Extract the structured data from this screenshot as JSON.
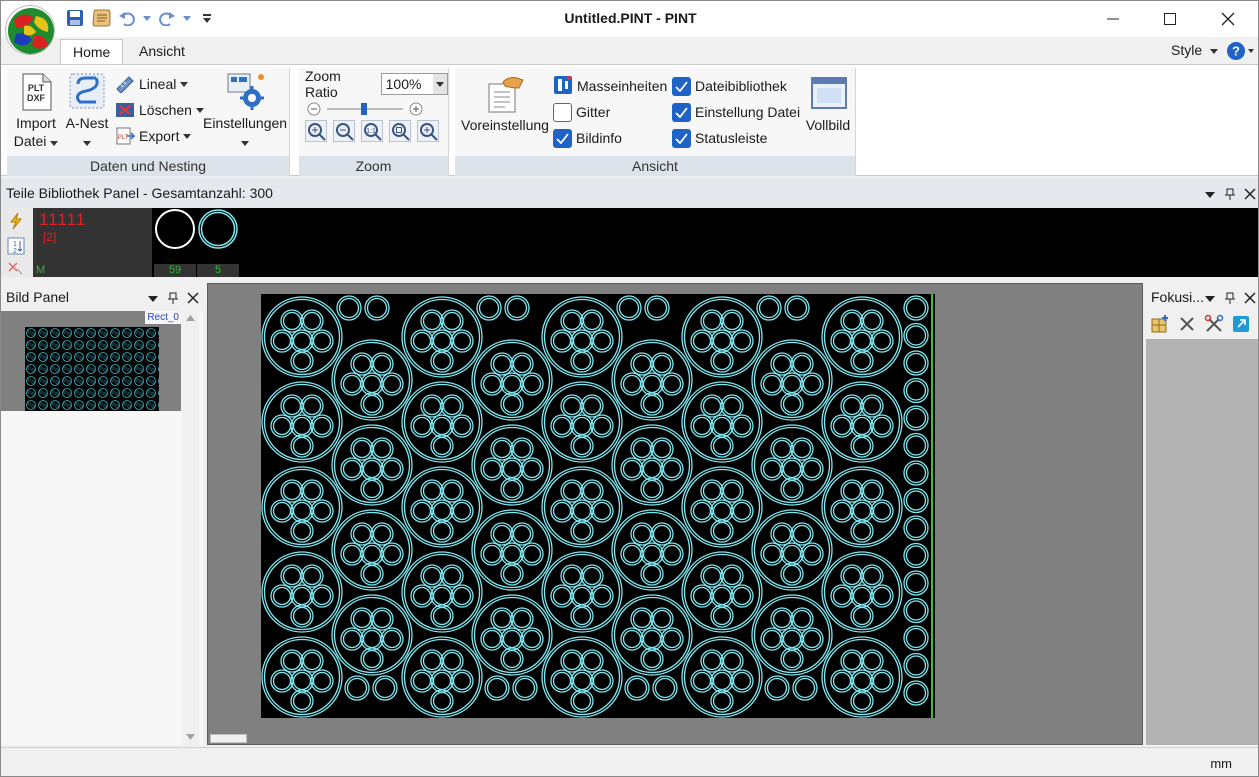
{
  "window": {
    "title": "Untitled.PINT - PINT"
  },
  "tabs": [
    {
      "label": "Home",
      "active": true
    },
    {
      "label": "Ansicht",
      "active": false
    }
  ],
  "style_menu": "Style",
  "ribbon": {
    "daten_group": {
      "label": "Daten und Nesting",
      "import_line1": "Import",
      "import_line2": "Datei",
      "anest": "A-Nest",
      "lineal": "Lineal",
      "loeschen": "Löschen",
      "export": "Export",
      "einstellungen": "Einstellungen"
    },
    "zoom_group": {
      "label": "Zoom",
      "ratio_label": "Zoom Ratio",
      "ratio_value": "100%"
    },
    "ansicht_group": {
      "label": "Ansicht",
      "voreinstellung": "Voreinstellung",
      "masseinheiten": "Masseinheiten",
      "gitter": "Gitter",
      "bildinfo": "Bildinfo",
      "dateibibliothek": "Dateibibliothek",
      "einstellung_datei": "Einstellung Datei",
      "statusleiste": "Statusleiste",
      "vollbild": "Vollbild",
      "checks": {
        "masseinheiten": true,
        "gitter": false,
        "bildinfo": true,
        "dateibibliothek": true,
        "einstellung_datei": true,
        "statusleiste": true
      }
    }
  },
  "parts_panel": {
    "title": "Teile Bibliothek Panel - Gesamtanzahl: 300",
    "part1_name": "11111",
    "part1_count": "[2]",
    "part1_tag": "M",
    "part2_count": "59",
    "part3_count": "5"
  },
  "bild_panel": {
    "title": "Bild Panel",
    "item_label": "Rect_0"
  },
  "fokus_panel": {
    "title": "Fokusi..."
  },
  "status": {
    "units": "mm"
  },
  "colors": {
    "accent": "#1e63c5",
    "part_outline": "#7fe8f0",
    "sheet_bg": "#000000",
    "canvas_bg": "#808080"
  }
}
